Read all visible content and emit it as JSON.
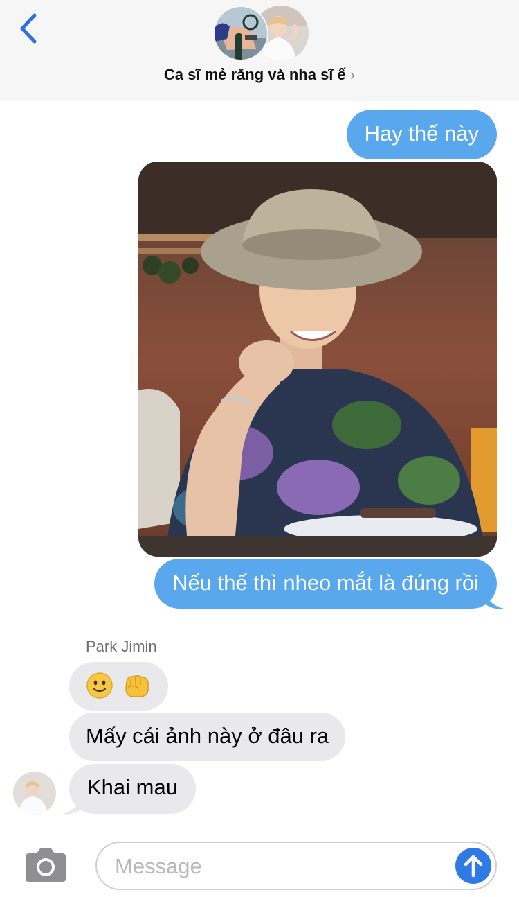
{
  "header": {
    "conversation_title": "Ca sĩ mẻ răng và nha sĩ ế",
    "chevron": "›"
  },
  "messages": {
    "out_1": "Hay thế này",
    "out_2": "Nếu thế thì nheo mắt là đúng rồi",
    "sender_name": "Park Jimin",
    "in_1_emojis": [
      "slightly-smiling-face",
      "fisted-hand"
    ],
    "in_2": "Mấy cái ảnh này ở đâu ra",
    "in_3": "Khai mau"
  },
  "composer": {
    "placeholder": "Message",
    "value": ""
  },
  "colors": {
    "outgoing_bubble": "#59a8ee",
    "incoming_bubble": "#e9e9eb",
    "accent_blue": "#2f7ae5",
    "header_bg": "#f6f6f6"
  },
  "icons": {
    "back": "chevron-left-icon",
    "camera": "camera-icon",
    "send": "arrow-up-icon"
  }
}
